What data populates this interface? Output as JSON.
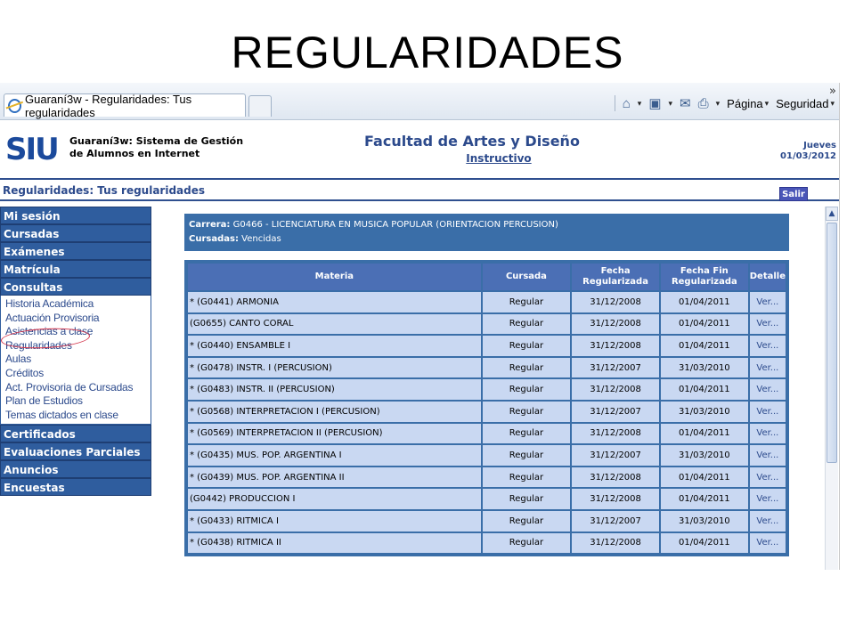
{
  "slide_title": "REGULARIDADES",
  "browser": {
    "tab_title": "Guaraní3w - Regularidades: Tus regularidades",
    "toolbar": {
      "page_label": "Página",
      "security_label": "Seguridad",
      "more": "»"
    }
  },
  "header": {
    "logo": "SIU",
    "system_line1": "Guaraní3w: Sistema de Gestión",
    "system_line2": "de Alumnos en Internet",
    "faculty": "Facultad de Artes y Diseño",
    "instructivo": "Instructivo",
    "weekday": "Jueves",
    "date": "01/03/2012"
  },
  "subheader": {
    "title": "Regularidades: Tus regularidades",
    "exit": "Salir"
  },
  "sidebar": {
    "groups": [
      {
        "label": "Mi sesión"
      },
      {
        "label": "Cursadas"
      },
      {
        "label": "Exámenes"
      },
      {
        "label": "Matrícula"
      },
      {
        "label": "Consultas"
      }
    ],
    "consultas_items": [
      "Historia Académica",
      "Actuación Provisoria",
      "Asistencias a clase",
      "Regularidades",
      "Aulas",
      "Créditos",
      "Act. Provisoria de Cursadas",
      "Plan de Estudios",
      "Temas dictados en clase"
    ],
    "groups_after": [
      {
        "label": "Certificados"
      },
      {
        "label": "Evaluaciones Parciales"
      },
      {
        "label": "Anuncios"
      },
      {
        "label": "Encuestas"
      }
    ]
  },
  "info": {
    "carrera_label": "Carrera:",
    "carrera_value": "G0466 - LICENCIATURA EN MUSICA POPULAR (ORIENTACION PERCUSION)",
    "cursadas_label": "Cursadas:",
    "cursadas_value": "Vencidas"
  },
  "table": {
    "headers": {
      "materia": "Materia",
      "cursada": "Cursada",
      "fecha_1": "Fecha",
      "fecha_2": "Regularizada",
      "fin_1": "Fecha Fin",
      "fin_2": "Regularizada",
      "detalle": "Detalle"
    },
    "rows": [
      {
        "materia": "* (G0441) ARMONIA",
        "cursada": "Regular",
        "fecha": "31/12/2008",
        "fin": "01/04/2011",
        "detalle": "Ver..."
      },
      {
        "materia": "(G0655) CANTO CORAL",
        "cursada": "Regular",
        "fecha": "31/12/2008",
        "fin": "01/04/2011",
        "detalle": "Ver..."
      },
      {
        "materia": "* (G0440) ENSAMBLE I",
        "cursada": "Regular",
        "fecha": "31/12/2008",
        "fin": "01/04/2011",
        "detalle": "Ver..."
      },
      {
        "materia": "* (G0478) INSTR. I (PERCUSION)",
        "cursada": "Regular",
        "fecha": "31/12/2007",
        "fin": "31/03/2010",
        "detalle": "Ver..."
      },
      {
        "materia": "* (G0483) INSTR. II (PERCUSION)",
        "cursada": "Regular",
        "fecha": "31/12/2008",
        "fin": "01/04/2011",
        "detalle": "Ver..."
      },
      {
        "materia": "* (G0568) INTERPRETACION I (PERCUSION)",
        "cursada": "Regular",
        "fecha": "31/12/2007",
        "fin": "31/03/2010",
        "detalle": "Ver..."
      },
      {
        "materia": "* (G0569) INTERPRETACION II (PERCUSION)",
        "cursada": "Regular",
        "fecha": "31/12/2008",
        "fin": "01/04/2011",
        "detalle": "Ver..."
      },
      {
        "materia": "* (G0435) MUS. POP. ARGENTINA I",
        "cursada": "Regular",
        "fecha": "31/12/2007",
        "fin": "31/03/2010",
        "detalle": "Ver..."
      },
      {
        "materia": "* (G0439) MUS. POP. ARGENTINA II",
        "cursada": "Regular",
        "fecha": "31/12/2008",
        "fin": "01/04/2011",
        "detalle": "Ver..."
      },
      {
        "materia": "(G0442) PRODUCCION I",
        "cursada": "Regular",
        "fecha": "31/12/2008",
        "fin": "01/04/2011",
        "detalle": "Ver..."
      },
      {
        "materia": "* (G0433) RITMICA I",
        "cursada": "Regular",
        "fecha": "31/12/2007",
        "fin": "31/03/2010",
        "detalle": "Ver..."
      },
      {
        "materia": "* (G0438) RITMICA II",
        "cursada": "Regular",
        "fecha": "31/12/2008",
        "fin": "01/04/2011",
        "detalle": "Ver..."
      }
    ]
  },
  "colors": {
    "menu_blue": "#2f5d9e",
    "header_text": "#2c4a8c",
    "table_header": "#4b6fb5",
    "table_cell": "#c9d8f2",
    "highlight_circle": "#d3334a"
  }
}
